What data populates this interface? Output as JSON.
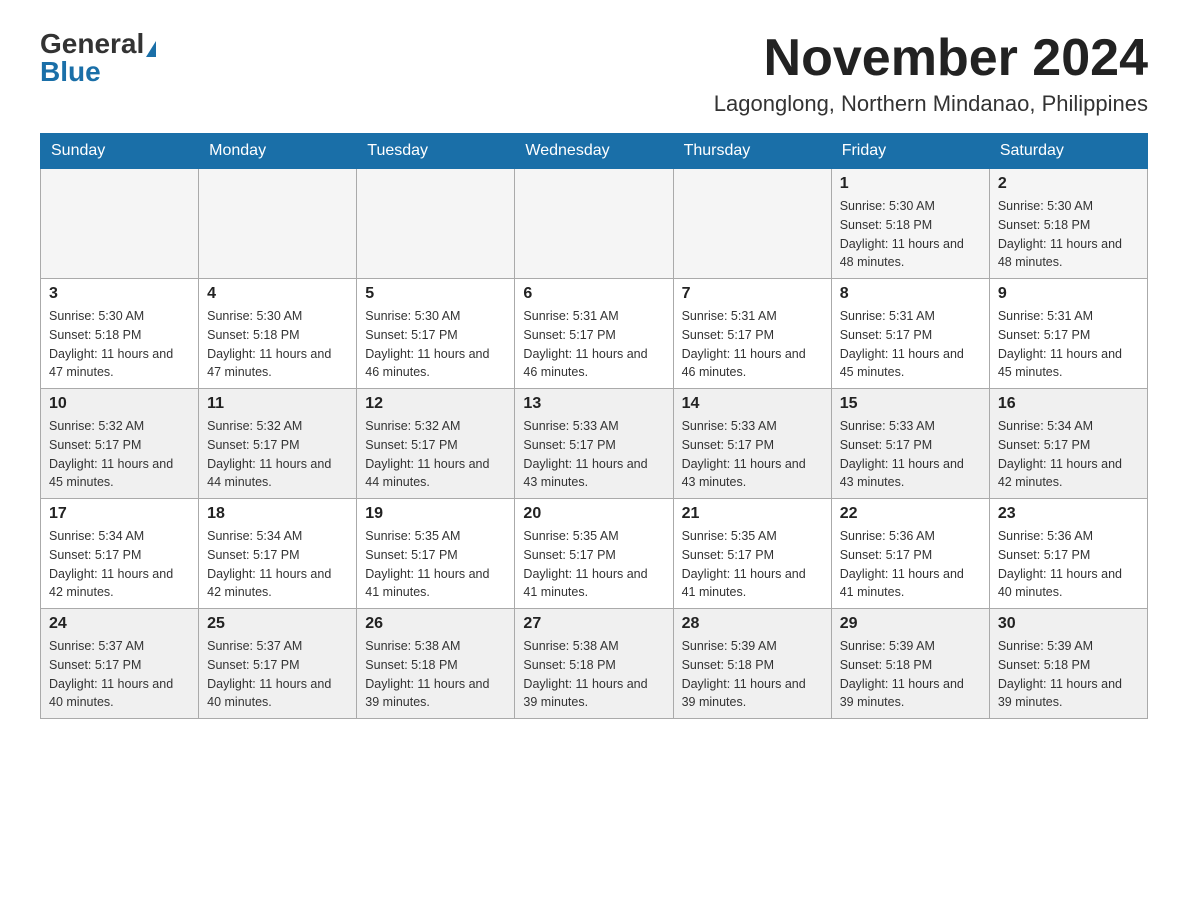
{
  "logo": {
    "general_text": "General",
    "blue_text": "Blue"
  },
  "header": {
    "month_year": "November 2024",
    "location": "Lagonglong, Northern Mindanao, Philippines"
  },
  "days_of_week": [
    "Sunday",
    "Monday",
    "Tuesday",
    "Wednesday",
    "Thursday",
    "Friday",
    "Saturday"
  ],
  "weeks": [
    [
      {
        "day": "",
        "info": ""
      },
      {
        "day": "",
        "info": ""
      },
      {
        "day": "",
        "info": ""
      },
      {
        "day": "",
        "info": ""
      },
      {
        "day": "",
        "info": ""
      },
      {
        "day": "1",
        "info": "Sunrise: 5:30 AM\nSunset: 5:18 PM\nDaylight: 11 hours and 48 minutes."
      },
      {
        "day": "2",
        "info": "Sunrise: 5:30 AM\nSunset: 5:18 PM\nDaylight: 11 hours and 48 minutes."
      }
    ],
    [
      {
        "day": "3",
        "info": "Sunrise: 5:30 AM\nSunset: 5:18 PM\nDaylight: 11 hours and 47 minutes."
      },
      {
        "day": "4",
        "info": "Sunrise: 5:30 AM\nSunset: 5:18 PM\nDaylight: 11 hours and 47 minutes."
      },
      {
        "day": "5",
        "info": "Sunrise: 5:30 AM\nSunset: 5:17 PM\nDaylight: 11 hours and 46 minutes."
      },
      {
        "day": "6",
        "info": "Sunrise: 5:31 AM\nSunset: 5:17 PM\nDaylight: 11 hours and 46 minutes."
      },
      {
        "day": "7",
        "info": "Sunrise: 5:31 AM\nSunset: 5:17 PM\nDaylight: 11 hours and 46 minutes."
      },
      {
        "day": "8",
        "info": "Sunrise: 5:31 AM\nSunset: 5:17 PM\nDaylight: 11 hours and 45 minutes."
      },
      {
        "day": "9",
        "info": "Sunrise: 5:31 AM\nSunset: 5:17 PM\nDaylight: 11 hours and 45 minutes."
      }
    ],
    [
      {
        "day": "10",
        "info": "Sunrise: 5:32 AM\nSunset: 5:17 PM\nDaylight: 11 hours and 45 minutes."
      },
      {
        "day": "11",
        "info": "Sunrise: 5:32 AM\nSunset: 5:17 PM\nDaylight: 11 hours and 44 minutes."
      },
      {
        "day": "12",
        "info": "Sunrise: 5:32 AM\nSunset: 5:17 PM\nDaylight: 11 hours and 44 minutes."
      },
      {
        "day": "13",
        "info": "Sunrise: 5:33 AM\nSunset: 5:17 PM\nDaylight: 11 hours and 43 minutes."
      },
      {
        "day": "14",
        "info": "Sunrise: 5:33 AM\nSunset: 5:17 PM\nDaylight: 11 hours and 43 minutes."
      },
      {
        "day": "15",
        "info": "Sunrise: 5:33 AM\nSunset: 5:17 PM\nDaylight: 11 hours and 43 minutes."
      },
      {
        "day": "16",
        "info": "Sunrise: 5:34 AM\nSunset: 5:17 PM\nDaylight: 11 hours and 42 minutes."
      }
    ],
    [
      {
        "day": "17",
        "info": "Sunrise: 5:34 AM\nSunset: 5:17 PM\nDaylight: 11 hours and 42 minutes."
      },
      {
        "day": "18",
        "info": "Sunrise: 5:34 AM\nSunset: 5:17 PM\nDaylight: 11 hours and 42 minutes."
      },
      {
        "day": "19",
        "info": "Sunrise: 5:35 AM\nSunset: 5:17 PM\nDaylight: 11 hours and 41 minutes."
      },
      {
        "day": "20",
        "info": "Sunrise: 5:35 AM\nSunset: 5:17 PM\nDaylight: 11 hours and 41 minutes."
      },
      {
        "day": "21",
        "info": "Sunrise: 5:35 AM\nSunset: 5:17 PM\nDaylight: 11 hours and 41 minutes."
      },
      {
        "day": "22",
        "info": "Sunrise: 5:36 AM\nSunset: 5:17 PM\nDaylight: 11 hours and 41 minutes."
      },
      {
        "day": "23",
        "info": "Sunrise: 5:36 AM\nSunset: 5:17 PM\nDaylight: 11 hours and 40 minutes."
      }
    ],
    [
      {
        "day": "24",
        "info": "Sunrise: 5:37 AM\nSunset: 5:17 PM\nDaylight: 11 hours and 40 minutes."
      },
      {
        "day": "25",
        "info": "Sunrise: 5:37 AM\nSunset: 5:17 PM\nDaylight: 11 hours and 40 minutes."
      },
      {
        "day": "26",
        "info": "Sunrise: 5:38 AM\nSunset: 5:18 PM\nDaylight: 11 hours and 39 minutes."
      },
      {
        "day": "27",
        "info": "Sunrise: 5:38 AM\nSunset: 5:18 PM\nDaylight: 11 hours and 39 minutes."
      },
      {
        "day": "28",
        "info": "Sunrise: 5:39 AM\nSunset: 5:18 PM\nDaylight: 11 hours and 39 minutes."
      },
      {
        "day": "29",
        "info": "Sunrise: 5:39 AM\nSunset: 5:18 PM\nDaylight: 11 hours and 39 minutes."
      },
      {
        "day": "30",
        "info": "Sunrise: 5:39 AM\nSunset: 5:18 PM\nDaylight: 11 hours and 39 minutes."
      }
    ]
  ]
}
